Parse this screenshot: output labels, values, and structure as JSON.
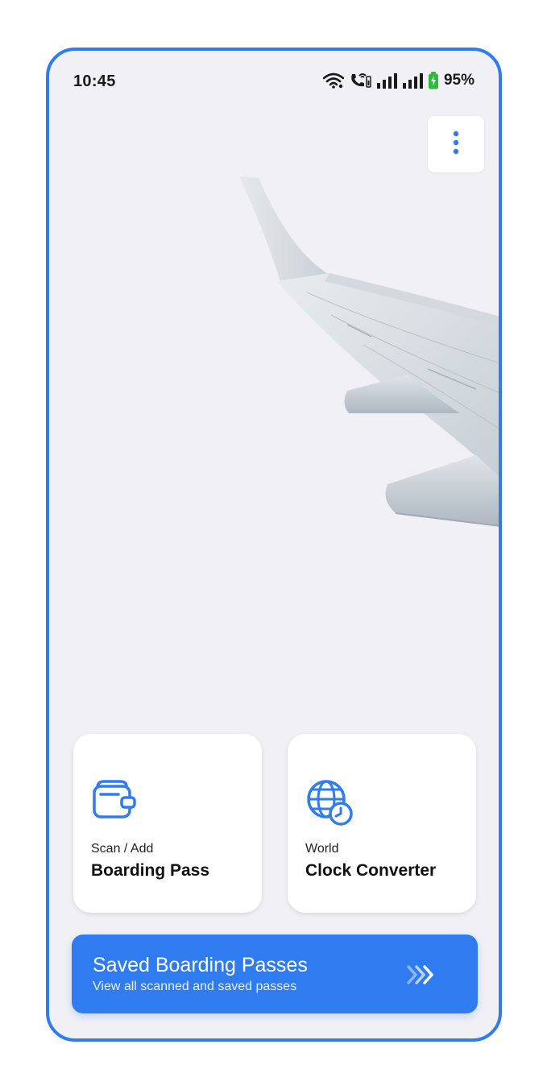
{
  "status_bar": {
    "time": "10:45",
    "battery": "95%",
    "icons": [
      "wifi-icon",
      "wifi-calling-icon",
      "signal-icon",
      "signal-icon",
      "battery-charging-icon"
    ]
  },
  "menu": {
    "icon": "more-vertical-icon"
  },
  "hero": {
    "image": "airplane-wing"
  },
  "cards": [
    {
      "subtitle": "Scan / Add",
      "title": "Boarding Pass",
      "icon": "wallet-icon"
    },
    {
      "subtitle": "World",
      "title": "Clock Converter",
      "icon": "globe-clock-icon"
    }
  ],
  "saved": {
    "title": "Saved Boarding Passes",
    "subtitle": "View all scanned and saved passes",
    "icon": "triple-chevron-right-icon"
  },
  "colors": {
    "accent": "#2f7cf0",
    "background": "#f1f1f5",
    "card": "#ffffff"
  }
}
